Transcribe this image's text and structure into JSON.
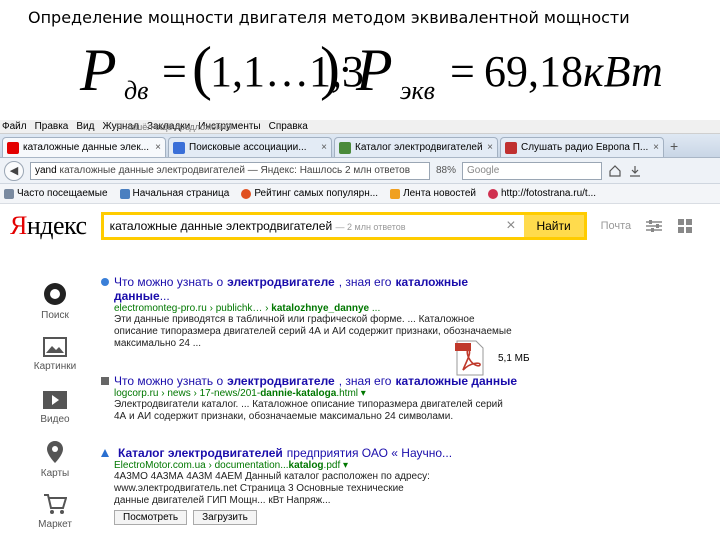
{
  "slide": {
    "title": "Определение мощности двигателя методом эквивалентной мощности",
    "formula": {
      "P": "P",
      "sub_dv": "дв",
      "eq": "=",
      "lparen": "(",
      "range": "1,1…1,3",
      "rparen": ")",
      "dot": "·",
      "sub_ekv": "экв",
      "eq2": "=",
      "result_value": "69,18",
      "result_unit": "кВт"
    }
  },
  "browser": {
    "menu": [
      "Файл",
      "Правка",
      "Вид",
      "Журнал",
      "Закладки",
      "Инструменты",
      "Справка"
    ],
    "tabs": [
      {
        "label": "каталожные данные элек...",
        "color": "#e30000",
        "active": true
      },
      {
        "label": "Поисковые ассоциации...",
        "color": "#3a6fd8",
        "active": false
      },
      {
        "label": "Каталог электродвигателей",
        "color": "#4a8a3a",
        "active": false
      },
      {
        "label": "Слушать радио Европа П...",
        "color": "#c03030",
        "active": false
      }
    ],
    "tab_close": "×",
    "tab_add": "+",
    "nav": {
      "back": "◀",
      "url_host": "yand",
      "url_text": "каталожные данные электродвигателей — Яндекс: Нашлось 2 млн ответов",
      "zoom": "88%",
      "search_placeholder": "Google"
    },
    "bookmarks": [
      {
        "label": "Часто посещаемые",
        "color": "#7a8aa0"
      },
      {
        "label": "Начальная страница",
        "color": "#4a7fc0"
      },
      {
        "label": "Рейтинг самых популярн...",
        "color": "#e05020"
      },
      {
        "label": "Лента новостей",
        "color": "#f0a020"
      },
      {
        "label": "http://fotostrana.ru/t...",
        "color": "#d03050"
      }
    ]
  },
  "yandex": {
    "logo_first": "Я",
    "logo_rest": "ндекс",
    "query": "каталожные данные электродвигателей",
    "query_hint": "— 2 млн ответов",
    "clear": "×",
    "find_button": "Найти",
    "mail_link": "Почта",
    "under_search": "Я нашёл ещё предложений",
    "left_nav": [
      {
        "label": "Поиск",
        "icon": "yandex-search-icon"
      },
      {
        "label": "Картинки",
        "icon": "image-icon"
      },
      {
        "label": "Видео",
        "icon": "video-icon"
      },
      {
        "label": "Карты",
        "icon": "map-pin-icon"
      },
      {
        "label": "Маркет",
        "icon": "cart-icon"
      }
    ],
    "results": [
      {
        "title_pre": "Что можно узнать о ",
        "title_bold": "электродвигателе",
        "title_post": ", зная его ",
        "title_bold2": "каталожные",
        "title_line2": "данные",
        "title_line2_post": "...",
        "url_pre": "electromonteg-pro.ru › publichk… › ",
        "url_bold": "katalozhnye_dannye",
        "url_post": " ...",
        "snippet": [
          "Эти данные приводятся в табличной или графической форме. ... Каталожное",
          "описание типоразмера двигателей серий 4А и АИ содержит признаки, обозначаемые",
          "максимально 24 ..."
        ]
      },
      {
        "title_pre": "Что можно узнать о ",
        "title_bold": "электродвигателе",
        "title_post": ", зная его ",
        "title_bold2": "каталожные данные",
        "url_pre": "logcorp.ru › news › 17-news/201-",
        "url_bold": "dannie-kataloga",
        "url_post": ".html ▾",
        "snippet": [
          "Электродвигатели каталог. ... Каталожное описание типоразмера двигателей серий",
          "4А и АИ содержит признаки, обозначаемые максимально 24 символами."
        ]
      },
      {
        "title_pre": "",
        "title_bold": "Каталог электродвигателей",
        "title_post": " предприятия ОАО « Научно...",
        "url_pre": "ElectroMotor.com.ua › documentation...",
        "url_bold": "katalog",
        "url_post": ".pdf ▾",
        "snippet": [
          "4А3МО 4А3МА 4А3М 4АЕМ Данный каталог расположен по адресу:",
          "www.электродвигатель.net Страница 3 Основные технические",
          "данные двигателей ГИП Мощн... кВт Напряж..."
        ],
        "buttons": [
          "Посмотреть",
          "Загрузить"
        ],
        "file_size": "5,1 МБ"
      }
    ]
  }
}
